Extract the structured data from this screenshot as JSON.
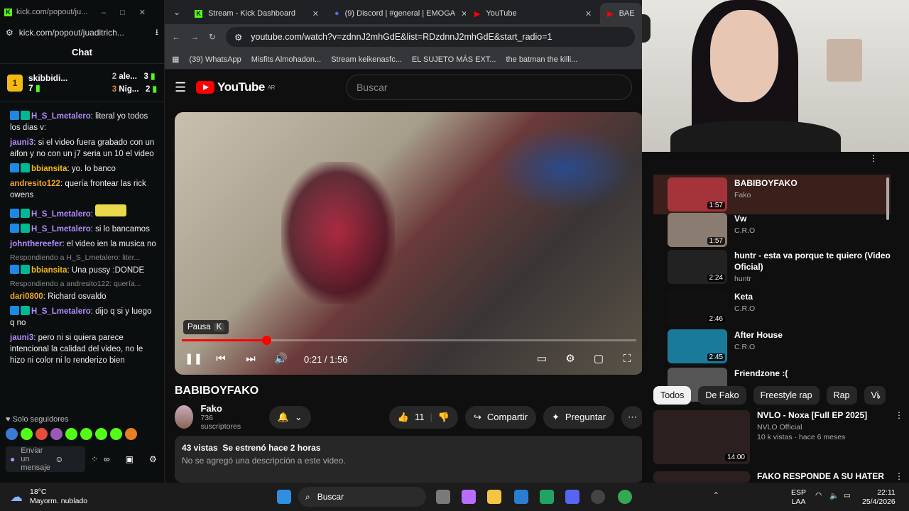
{
  "kick": {
    "window_url_short": "kick.com/popout/ju...",
    "url": "kick.com/popout/juaditrich...",
    "chat_title": "Chat",
    "leaders": [
      {
        "rank": "1",
        "name": "skibbidi...",
        "count": "7"
      },
      {
        "rank": "2",
        "name": "ale...",
        "count": "3"
      },
      {
        "rank": "3",
        "name": "Nig...",
        "count": "2"
      }
    ],
    "messages": [
      {
        "user": "H_S_Lmetalero",
        "text": "literal yo todos los dias v:",
        "color": "#b58cff"
      },
      {
        "user": "jauni3",
        "text": "si el video fuera grabado con un aifon y no con un j7 seria un 10 el video",
        "color": "#b58cff"
      },
      {
        "user": "bbiansita",
        "text": "yo. lo banco",
        "color": "#f5b914"
      },
      {
        "user": "andresito122",
        "text": "quería frontear las rick owens",
        "color": "#f5a623"
      },
      {
        "user": "H_S_Lmetalero",
        "text": "",
        "color": "#b58cff"
      },
      {
        "user": "H_S_Lmetalero",
        "text": "si lo bancamos",
        "color": "#b58cff"
      },
      {
        "user": "johnthereefer",
        "text": "el video ien la musica no",
        "color": "#b58cff"
      },
      {
        "reply": "Respondiendo a H_S_Lmetalero: liter..."
      },
      {
        "user": "bbiansita",
        "text": "Una pussy :DONDE",
        "color": "#f5b914"
      },
      {
        "reply": "Respondiendo a andresito122: quería..."
      },
      {
        "user": "dari0800",
        "text": "Richard osvaldo",
        "color": "#f5a623"
      },
      {
        "user": "H_S_Lmetalero",
        "text": "dijo q si y luego q no",
        "color": "#b58cff"
      },
      {
        "user": "jauni3",
        "text": "pero ni si quiera parece intencional la calidad del video, no le hizo ni color ni lo renderizo bien",
        "color": "#b58cff"
      }
    ],
    "followers_only": "Solo seguidores",
    "send_placeholder": "Enviar un mensaje"
  },
  "browser": {
    "tabs": [
      {
        "label": "Stream - Kick Dashboard",
        "color": "#53fc18"
      },
      {
        "label": "(9) Discord | #general | EMOGA",
        "color": "#5865f2"
      },
      {
        "label": "YouTube",
        "color": "#ff0000"
      },
      {
        "label": "BAE",
        "color": "#ff0000"
      }
    ],
    "url": "youtube.com/watch?v=zdnnJ2mhGdE&list=RDzdnnJ2mhGdE&start_radio=1",
    "bookmarks": [
      "(39) WhatsApp",
      "Misfits Almohadon...",
      "Stream keikenasfc...",
      "EL SUJETO MÁS EXT...",
      "the batman the killi..."
    ]
  },
  "youtube": {
    "logo": "YouTube",
    "region": "AR",
    "search_placeholder": "Buscar",
    "tooltip": "Pausa",
    "tooltip_key": "K",
    "time": "0:21 / 1:56",
    "progress": 0.186,
    "video_title": "BABIBOYFAKO",
    "channel": "Fako",
    "subscribers": "736 suscriptores",
    "likes": "11",
    "share": "Compartir",
    "ask": "Preguntar",
    "views": "43 vistas",
    "premiered": "Se estrenó hace 2 horas",
    "description": "No se agregó una descripción a este video."
  },
  "playlist": [
    {
      "title": "BABIBOYFAKO",
      "channel": "Fako",
      "dur": "1:57",
      "thumb": "#a5343a"
    },
    {
      "title": "Vw",
      "channel": "C.R.O",
      "dur": "1:57",
      "thumb": "#8a7c70"
    },
    {
      "title": "huntr - esta va porque te quiero (Video Oficial)",
      "channel": "huntr",
      "dur": "2:24",
      "thumb": "#222"
    },
    {
      "title": "Keta",
      "channel": "C.R.O",
      "dur": "2:46",
      "thumb": "#111"
    },
    {
      "title": "After House",
      "channel": "C.R.O",
      "dur": "2:45",
      "thumb": "#1a7a9a"
    },
    {
      "title": "Friendzone :(",
      "channel": "",
      "dur": "",
      "thumb": "#555"
    }
  ],
  "chips": [
    "Todos",
    "De Fako",
    "Freestyle rap",
    "Rap",
    "Vi"
  ],
  "recs": [
    {
      "title": "NVLO - Noxa [Full EP 2025]",
      "channel": "NVLO Official",
      "meta": "10 k vistas · hace 6 meses",
      "dur": "14:00"
    },
    {
      "title": "FAKO RESPONDE A SU HATER",
      "channel": "",
      "meta": "",
      "dur": ""
    }
  ],
  "taskbar": {
    "temp": "18°C",
    "weather": "Mayorm. nublado",
    "search": "Buscar",
    "lang1": "ESP",
    "lang2": "LAA",
    "time": "22:11",
    "date": "25/4/2026"
  }
}
